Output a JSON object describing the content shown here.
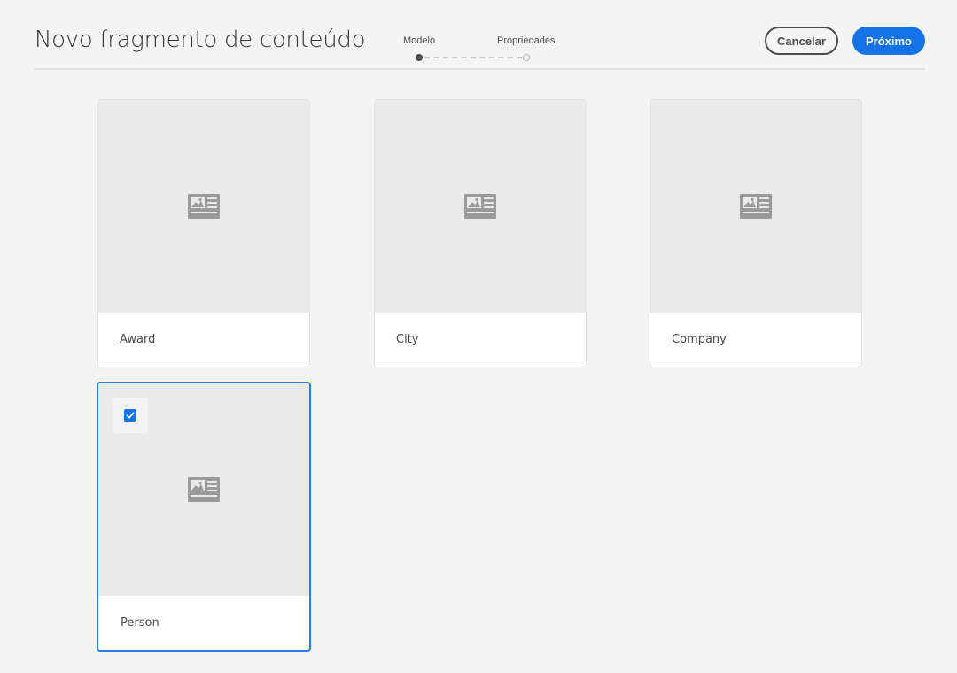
{
  "header": {
    "title": "Novo fragmento de conteúdo",
    "steps": [
      {
        "label": "Modelo",
        "state": "active"
      },
      {
        "label": "Propriedades",
        "state": "inactive"
      }
    ],
    "cancel_label": "Cancelar",
    "next_label": "Próximo"
  },
  "models": [
    {
      "label": "Award",
      "selected": false,
      "icon": "content-fragment-icon"
    },
    {
      "label": "City",
      "selected": false,
      "icon": "content-fragment-icon"
    },
    {
      "label": "Company",
      "selected": false,
      "icon": "content-fragment-icon"
    },
    {
      "label": "Person",
      "selected": true,
      "icon": "content-fragment-icon"
    }
  ],
  "colors": {
    "accent": "#1473e6",
    "selected_border": "#2680eb",
    "thumb_bg": "#eaeaea",
    "icon": "#9a9a9a"
  }
}
